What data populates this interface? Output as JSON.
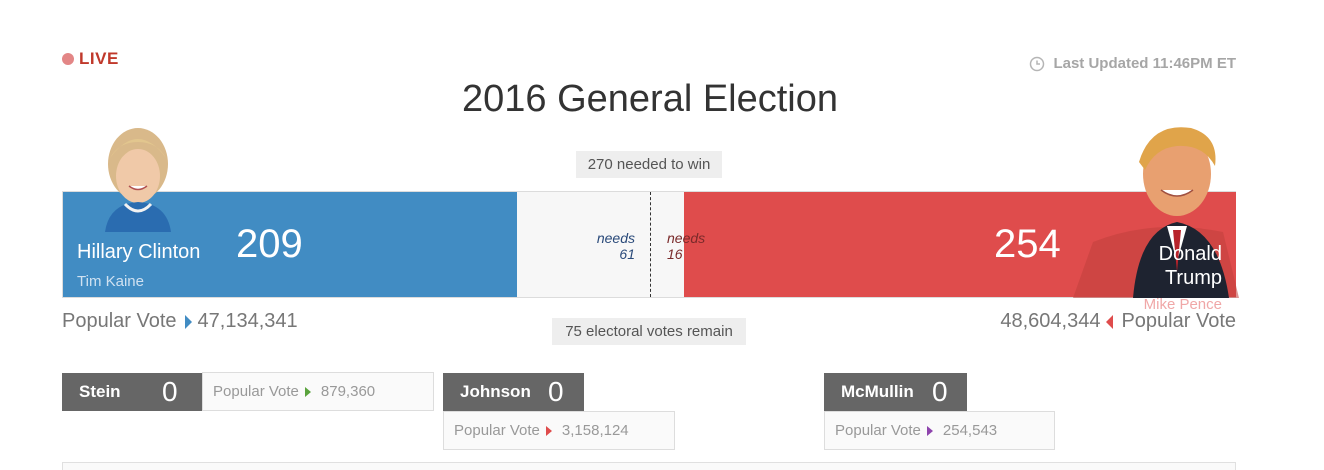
{
  "live": {
    "label": "LIVE"
  },
  "updated": {
    "text": "Last Updated 11:46PM ET",
    "icon": "clock-icon"
  },
  "title": "2016 General Election",
  "needed_to_win": "270 needed to win",
  "remaining": "75 electoral votes remain",
  "colors": {
    "dem": "#418cc3",
    "rep": "#df4c4c",
    "third": "#666666",
    "live": "#c0392b"
  },
  "democrat": {
    "name": "Hillary Clinton",
    "vp": "Tim Kaine",
    "electoral_votes": "209",
    "needs_label": "needs",
    "needs_value": "61",
    "popular_label": "Popular Vote",
    "popular_votes": "47,134,341"
  },
  "republican": {
    "name": "Donald Trump",
    "vp": "Mike Pence",
    "electoral_votes": "254",
    "needs_label": "needs",
    "needs_value": "16",
    "popular_label": "Popular Vote",
    "popular_votes": "48,604,344"
  },
  "third_party": [
    {
      "name": "Stein",
      "electoral_votes": "0",
      "popular_label": "Popular Vote",
      "popular_votes": "879,360",
      "arrow_color": "#5aa33d"
    },
    {
      "name": "Johnson",
      "electoral_votes": "0",
      "popular_label": "Popular Vote",
      "popular_votes": "3,158,124",
      "arrow_color": "#df4c4c"
    },
    {
      "name": "McMullin",
      "electoral_votes": "0",
      "popular_label": "Popular Vote",
      "popular_votes": "254,543",
      "arrow_color": "#8e44ad"
    }
  ]
}
